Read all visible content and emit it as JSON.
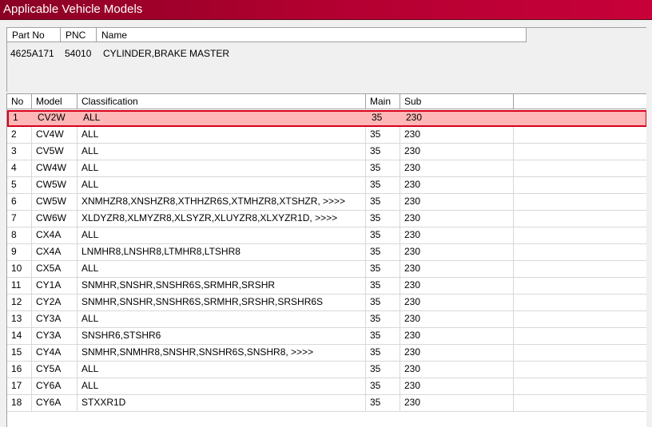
{
  "window": {
    "title": "Applicable Vehicle Models"
  },
  "part_panel": {
    "headers": {
      "part_no": "Part No",
      "pnc": "PNC",
      "name": "Name"
    },
    "values": {
      "part_no": "4625A171",
      "pnc": "54010",
      "name": "CYLINDER,BRAKE MASTER"
    }
  },
  "table": {
    "headers": {
      "no": "No",
      "model": "Model",
      "classification": "Classification",
      "main": "Main",
      "sub": "Sub"
    },
    "selected_index": 0,
    "rows": [
      {
        "no": "1",
        "model": "CV2W",
        "classification": "ALL",
        "main": "35",
        "sub": "230"
      },
      {
        "no": "2",
        "model": "CV4W",
        "classification": "ALL",
        "main": "35",
        "sub": "230"
      },
      {
        "no": "3",
        "model": "CV5W",
        "classification": "ALL",
        "main": "35",
        "sub": "230"
      },
      {
        "no": "4",
        "model": "CW4W",
        "classification": "ALL",
        "main": "35",
        "sub": "230"
      },
      {
        "no": "5",
        "model": "CW5W",
        "classification": "ALL",
        "main": "35",
        "sub": "230"
      },
      {
        "no": "6",
        "model": "CW5W",
        "classification": "XNMHZR8,XNSHZR8,XTHHZR6S,XTMHZR8,XTSHZR,  >>>>",
        "main": "35",
        "sub": "230"
      },
      {
        "no": "7",
        "model": "CW6W",
        "classification": "XLDYZR8,XLMYZR8,XLSYZR,XLUYZR8,XLXYZR1D,  >>>>",
        "main": "35",
        "sub": "230"
      },
      {
        "no": "8",
        "model": "CX4A",
        "classification": "ALL",
        "main": "35",
        "sub": "230"
      },
      {
        "no": "9",
        "model": "CX4A",
        "classification": "LNMHR8,LNSHR8,LTMHR8,LTSHR8",
        "main": "35",
        "sub": "230"
      },
      {
        "no": "10",
        "model": "CX5A",
        "classification": "ALL",
        "main": "35",
        "sub": "230"
      },
      {
        "no": "11",
        "model": "CY1A",
        "classification": "SNMHR,SNSHR,SNSHR6S,SRMHR,SRSHR",
        "main": "35",
        "sub": "230"
      },
      {
        "no": "12",
        "model": "CY2A",
        "classification": "SNMHR,SNSHR,SNSHR6S,SRMHR,SRSHR,SRSHR6S",
        "main": "35",
        "sub": "230"
      },
      {
        "no": "13",
        "model": "CY3A",
        "classification": "ALL",
        "main": "35",
        "sub": "230"
      },
      {
        "no": "14",
        "model": "CY3A",
        "classification": "SNSHR6,STSHR6",
        "main": "35",
        "sub": "230"
      },
      {
        "no": "15",
        "model": "CY4A",
        "classification": "SNMHR,SNMHR8,SNSHR,SNSHR6S,SNSHR8,  >>>>",
        "main": "35",
        "sub": "230"
      },
      {
        "no": "16",
        "model": "CY5A",
        "classification": "ALL",
        "main": "35",
        "sub": "230"
      },
      {
        "no": "17",
        "model": "CY6A",
        "classification": "ALL",
        "main": "35",
        "sub": "230"
      },
      {
        "no": "18",
        "model": "CY6A",
        "classification": "STXXR1D",
        "main": "35",
        "sub": "230"
      }
    ]
  }
}
